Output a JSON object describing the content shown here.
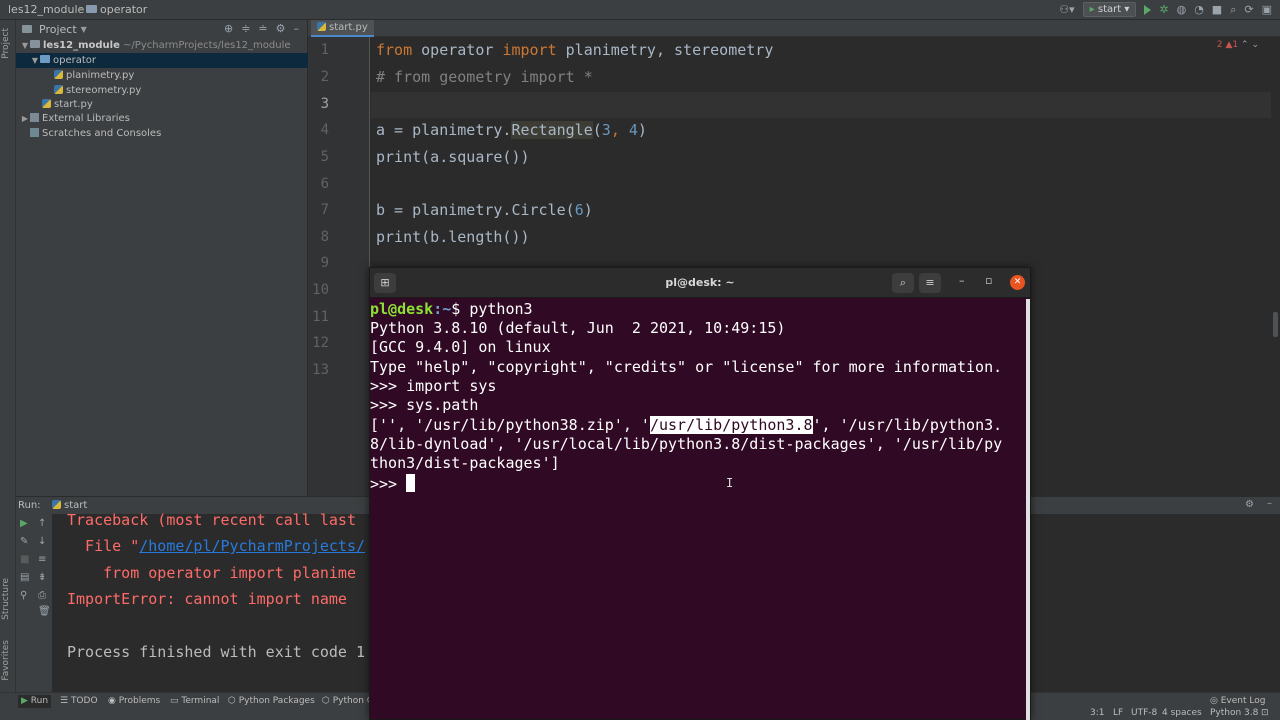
{
  "navbar": {
    "project_name": "les12_module",
    "folder": "operator",
    "run_config": "start"
  },
  "project_panel": {
    "title": "Project",
    "tree": [
      {
        "label": "les12_module",
        "suffix": "~/PycharmProjects/les12_module"
      },
      {
        "label": "operator"
      },
      {
        "label": "planimetry.py"
      },
      {
        "label": "stereometry.py"
      },
      {
        "label": "start.py"
      },
      {
        "label": "External Libraries"
      },
      {
        "label": "Scratches and Consoles"
      }
    ]
  },
  "left_stripe": {
    "project": "Project",
    "structure": "Structure",
    "favorites": "Favorites"
  },
  "editor": {
    "tab": "start.py",
    "inspection": "2 ▲1",
    "line_numbers": [
      "1",
      "2",
      "3",
      "4",
      "5",
      "6",
      "7",
      "8",
      "9",
      "10",
      "11",
      "12",
      "13"
    ],
    "lines": {
      "l1_from": "from",
      "l1_mod": " operator ",
      "l1_import": "import",
      "l1_rest": " planimetry, stereometry",
      "l2": "# from geometry import *",
      "l4_a": "a = planimetry.",
      "l4_cls": "Rectangle",
      "l4_open": "(",
      "l4_n1": "3",
      "l4_sep": ", ",
      "l4_n2": "4",
      "l4_close": ")",
      "l5": "print(a.square())",
      "l7_a": "b = planimetry.Circle(",
      "l7_n": "6",
      "l7_close": ")",
      "l8": "print(b.length())"
    }
  },
  "run_panel": {
    "label": "Run:",
    "tab": "start",
    "lines": {
      "tb": "Traceback (most recent call last",
      "file_pre": "  File \"",
      "file_link": "/home/pl/PycharmProjects/",
      "from_line": "    from operator import planime",
      "import_err": "ImportError: cannot import name ",
      "process": "Process finished with exit code 1"
    }
  },
  "status_bar": {
    "tabs": [
      "Run",
      "TODO",
      "Problems",
      "Terminal",
      "Python Packages",
      "Python Co"
    ],
    "event_log": "Event Log",
    "position": "3:1",
    "line_sep": "LF",
    "encoding": "UTF-8",
    "indent": "4 spaces",
    "interpreter": "Python 3.8"
  },
  "terminal": {
    "title": "pl@desk: ~",
    "prompt_user": "pl@desk",
    "prompt_dir": ":~",
    "prompt_cmd": "$ python3",
    "l2": "Python 3.8.10 (default, Jun  2 2021, 10:49:15)",
    "l3": "[GCC 9.4.0] on linux",
    "l4": "Type \"help\", \"copyright\", \"credits\" or \"license\" for more information.",
    "l5": ">>> import sys",
    "l6": ">>> sys.path",
    "l7_a": "['', '/usr/lib/python38.zip', '",
    "l7_sel": "/usr/lib/python3.8",
    "l7_b": "', '/usr/lib/python3.",
    "l8": "8/lib-dynload', '/usr/local/lib/python3.8/dist-packages', '/usr/lib/py",
    "l9": "thon3/dist-packages']",
    "l10": ">>> "
  },
  "colors": {
    "terminal_bg": "#300a24",
    "ide_bg": "#2b2b2b",
    "keyword": "#cc7832",
    "error": "#ff6b68",
    "prompt_green": "#8ae234",
    "prompt_blue": "#729fcf"
  }
}
